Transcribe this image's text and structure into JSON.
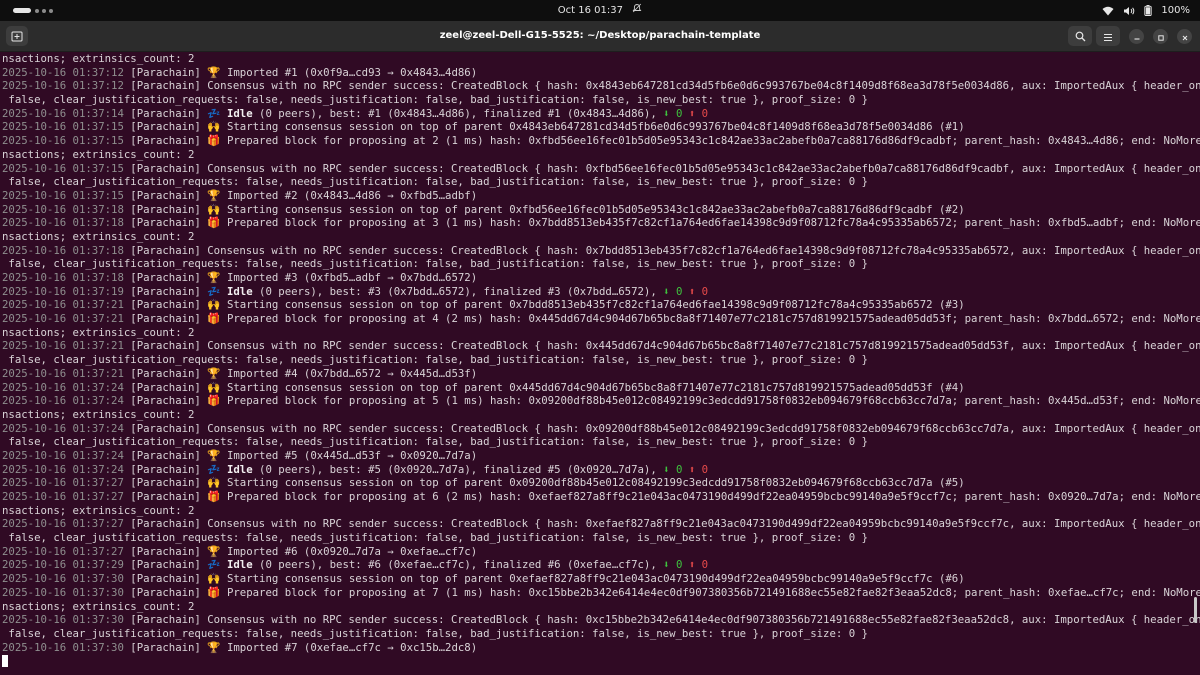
{
  "topbar": {
    "clock": "Oct 16  01:37",
    "battery": "100%",
    "icons": [
      "wifi-icon",
      "volume-icon",
      "battery-icon",
      "bell-muted-icon"
    ]
  },
  "window": {
    "title": "zeel@zeel-Dell-G15-5525: ~/Desktop/parachain-template",
    "buttons": [
      "new-tab-icon",
      "search-icon",
      "menu-icon",
      "minimize-icon",
      "maximize-icon",
      "close-icon"
    ]
  },
  "colors": {
    "background": "#300a24",
    "timestamp": "#8f8f8f",
    "text": "#d9d3d7",
    "green_arrow": "#3ec23e",
    "red_arrow": "#e64a4a"
  },
  "terminal": {
    "lines": [
      [
        {
          "t": "nsactions; extrinsics_count: 2"
        }
      ],
      [
        {
          "t": "2025-10-16 01:37:12",
          "c": "ts"
        },
        {
          "t": " [Parachain] 🏆 Imported #1 (0x0f9a…cd93 → 0x4843…4d86)"
        }
      ],
      [
        {
          "t": "2025-10-16 01:37:12",
          "c": "ts"
        },
        {
          "t": " [Parachain] Consensus with no RPC sender success: CreatedBlock { hash: 0x4843eb647281cd34d5fb6e0d6c993767be04c8f1409d8f68ea3d78f5e0034d86, aux: ImportedAux { header_only:"
        }
      ],
      [
        {
          "t": " false, clear_justification_requests: false, needs_justification: false, bad_justification: false, is_new_best: true }, proof_size: 0 }"
        }
      ],
      [
        {
          "t": "2025-10-16 01:37:14",
          "c": "ts"
        },
        {
          "t": " [Parachain] 💤 "
        },
        {
          "t": "Idle",
          "c": "bold"
        },
        {
          "t": " (0 peers), best: #1 (0x4843…4d86), finalized #1 (0x4843…4d86), "
        },
        {
          "t": "⬇ 0",
          "c": "green"
        },
        {
          "t": " "
        },
        {
          "t": "⬆ 0",
          "c": "red"
        }
      ],
      [
        {
          "t": "2025-10-16 01:37:15",
          "c": "ts"
        },
        {
          "t": " [Parachain] 🙌 Starting consensus session on top of parent 0x4843eb647281cd34d5fb6e0d6c993767be04c8f1409d8f68ea3d78f5e0034d86 (#1)"
        }
      ],
      [
        {
          "t": "2025-10-16 01:37:15",
          "c": "ts"
        },
        {
          "t": " [Parachain] 🎁 Prepared block for proposing at 2 (1 ms) hash: 0xfbd56ee16fec01b5d05e95343c1c842ae33ac2abefb0a7ca88176d86df9cadbf; parent_hash: 0x4843…4d86; end: NoMoreTra"
        }
      ],
      [
        {
          "t": "nsactions; extrinsics_count: 2"
        }
      ],
      [
        {
          "t": "2025-10-16 01:37:15",
          "c": "ts"
        },
        {
          "t": " [Parachain] Consensus with no RPC sender success: CreatedBlock { hash: 0xfbd56ee16fec01b5d05e95343c1c842ae33ac2abefb0a7ca88176d86df9cadbf, aux: ImportedAux { header_only:"
        }
      ],
      [
        {
          "t": " false, clear_justification_requests: false, needs_justification: false, bad_justification: false, is_new_best: true }, proof_size: 0 }"
        }
      ],
      [
        {
          "t": "2025-10-16 01:37:15",
          "c": "ts"
        },
        {
          "t": " [Parachain] 🏆 Imported #2 (0x4843…4d86 → 0xfbd5…adbf)"
        }
      ],
      [
        {
          "t": "2025-10-16 01:37:18",
          "c": "ts"
        },
        {
          "t": " [Parachain] 🙌 Starting consensus session on top of parent 0xfbd56ee16fec01b5d05e95343c1c842ae33ac2abefb0a7ca88176d86df9cadbf (#2)"
        }
      ],
      [
        {
          "t": "2025-10-16 01:37:18",
          "c": "ts"
        },
        {
          "t": " [Parachain] 🎁 Prepared block for proposing at 3 (1 ms) hash: 0x7bdd8513eb435f7c82cf1a764ed6fae14398c9d9f08712fc78a4c95335ab6572; parent_hash: 0xfbd5…adbf; end: NoMoreTra"
        }
      ],
      [
        {
          "t": "nsactions; extrinsics_count: 2"
        }
      ],
      [
        {
          "t": "2025-10-16 01:37:18",
          "c": "ts"
        },
        {
          "t": " [Parachain] Consensus with no RPC sender success: CreatedBlock { hash: 0x7bdd8513eb435f7c82cf1a764ed6fae14398c9d9f08712fc78a4c95335ab6572, aux: ImportedAux { header_only:"
        }
      ],
      [
        {
          "t": " false, clear_justification_requests: false, needs_justification: false, bad_justification: false, is_new_best: true }, proof_size: 0 }"
        }
      ],
      [
        {
          "t": "2025-10-16 01:37:18",
          "c": "ts"
        },
        {
          "t": " [Parachain] 🏆 Imported #3 (0xfbd5…adbf → 0x7bdd…6572)"
        }
      ],
      [
        {
          "t": "2025-10-16 01:37:19",
          "c": "ts"
        },
        {
          "t": " [Parachain] 💤 "
        },
        {
          "t": "Idle",
          "c": "bold"
        },
        {
          "t": " (0 peers), best: #3 (0x7bdd…6572), finalized #3 (0x7bdd…6572), "
        },
        {
          "t": "⬇ 0",
          "c": "green"
        },
        {
          "t": " "
        },
        {
          "t": "⬆ 0",
          "c": "red"
        }
      ],
      [
        {
          "t": "2025-10-16 01:37:21",
          "c": "ts"
        },
        {
          "t": " [Parachain] 🙌 Starting consensus session on top of parent 0x7bdd8513eb435f7c82cf1a764ed6fae14398c9d9f08712fc78a4c95335ab6572 (#3)"
        }
      ],
      [
        {
          "t": "2025-10-16 01:37:21",
          "c": "ts"
        },
        {
          "t": " [Parachain] 🎁 Prepared block for proposing at 4 (2 ms) hash: 0x445dd67d4c904d67b65bc8a8f71407e77c2181c757d819921575adead05dd53f; parent_hash: 0x7bdd…6572; end: NoMoreTra"
        }
      ],
      [
        {
          "t": "nsactions; extrinsics_count: 2"
        }
      ],
      [
        {
          "t": "2025-10-16 01:37:21",
          "c": "ts"
        },
        {
          "t": " [Parachain] Consensus with no RPC sender success: CreatedBlock { hash: 0x445dd67d4c904d67b65bc8a8f71407e77c2181c757d819921575adead05dd53f, aux: ImportedAux { header_only:"
        }
      ],
      [
        {
          "t": " false, clear_justification_requests: false, needs_justification: false, bad_justification: false, is_new_best: true }, proof_size: 0 }"
        }
      ],
      [
        {
          "t": "2025-10-16 01:37:21",
          "c": "ts"
        },
        {
          "t": " [Parachain] 🏆 Imported #4 (0x7bdd…6572 → 0x445d…d53f)"
        }
      ],
      [
        {
          "t": "2025-10-16 01:37:24",
          "c": "ts"
        },
        {
          "t": " [Parachain] 🙌 Starting consensus session on top of parent 0x445dd67d4c904d67b65bc8a8f71407e77c2181c757d819921575adead05dd53f (#4)"
        }
      ],
      [
        {
          "t": "2025-10-16 01:37:24",
          "c": "ts"
        },
        {
          "t": " [Parachain] 🎁 Prepared block for proposing at 5 (1 ms) hash: 0x09200df88b45e012c08492199c3edcdd91758f0832eb094679f68ccb63cc7d7a; parent_hash: 0x445d…d53f; end: NoMoreTra"
        }
      ],
      [
        {
          "t": "nsactions; extrinsics_count: 2"
        }
      ],
      [
        {
          "t": "2025-10-16 01:37:24",
          "c": "ts"
        },
        {
          "t": " [Parachain] Consensus with no RPC sender success: CreatedBlock { hash: 0x09200df88b45e012c08492199c3edcdd91758f0832eb094679f68ccb63cc7d7a, aux: ImportedAux { header_only:"
        }
      ],
      [
        {
          "t": " false, clear_justification_requests: false, needs_justification: false, bad_justification: false, is_new_best: true }, proof_size: 0 }"
        }
      ],
      [
        {
          "t": "2025-10-16 01:37:24",
          "c": "ts"
        },
        {
          "t": " [Parachain] 🏆 Imported #5 (0x445d…d53f → 0x0920…7d7a)"
        }
      ],
      [
        {
          "t": "2025-10-16 01:37:24",
          "c": "ts"
        },
        {
          "t": " [Parachain] 💤 "
        },
        {
          "t": "Idle",
          "c": "bold"
        },
        {
          "t": " (0 peers), best: #5 (0x0920…7d7a), finalized #5 (0x0920…7d7a), "
        },
        {
          "t": "⬇ 0",
          "c": "green"
        },
        {
          "t": " "
        },
        {
          "t": "⬆ 0",
          "c": "red"
        }
      ],
      [
        {
          "t": "2025-10-16 01:37:27",
          "c": "ts"
        },
        {
          "t": " [Parachain] 🙌 Starting consensus session on top of parent 0x09200df88b45e012c08492199c3edcdd91758f0832eb094679f68ccb63cc7d7a (#5)"
        }
      ],
      [
        {
          "t": "2025-10-16 01:37:27",
          "c": "ts"
        },
        {
          "t": " [Parachain] 🎁 Prepared block for proposing at 6 (2 ms) hash: 0xefaef827a8ff9c21e043ac0473190d499df22ea04959bcbc99140a9e5f9ccf7c; parent_hash: 0x0920…7d7a; end: NoMoreTra"
        }
      ],
      [
        {
          "t": "nsactions; extrinsics_count: 2"
        }
      ],
      [
        {
          "t": "2025-10-16 01:37:27",
          "c": "ts"
        },
        {
          "t": " [Parachain] Consensus with no RPC sender success: CreatedBlock { hash: 0xefaef827a8ff9c21e043ac0473190d499df22ea04959bcbc99140a9e5f9ccf7c, aux: ImportedAux { header_only:"
        }
      ],
      [
        {
          "t": " false, clear_justification_requests: false, needs_justification: false, bad_justification: false, is_new_best: true }, proof_size: 0 }"
        }
      ],
      [
        {
          "t": "2025-10-16 01:37:27",
          "c": "ts"
        },
        {
          "t": " [Parachain] 🏆 Imported #6 (0x0920…7d7a → 0xefae…cf7c)"
        }
      ],
      [
        {
          "t": "2025-10-16 01:37:29",
          "c": "ts"
        },
        {
          "t": " [Parachain] 💤 "
        },
        {
          "t": "Idle",
          "c": "bold"
        },
        {
          "t": " (0 peers), best: #6 (0xefae…cf7c), finalized #6 (0xefae…cf7c), "
        },
        {
          "t": "⬇ 0",
          "c": "green"
        },
        {
          "t": " "
        },
        {
          "t": "⬆ 0",
          "c": "red"
        }
      ],
      [
        {
          "t": "2025-10-16 01:37:30",
          "c": "ts"
        },
        {
          "t": " [Parachain] 🙌 Starting consensus session on top of parent 0xefaef827a8ff9c21e043ac0473190d499df22ea04959bcbc99140a9e5f9ccf7c (#6)"
        }
      ],
      [
        {
          "t": "2025-10-16 01:37:30",
          "c": "ts"
        },
        {
          "t": " [Parachain] 🎁 Prepared block for proposing at 7 (1 ms) hash: 0xc15bbe2b342e6414e4ec0df907380356b721491688ec55e82fae82f3eaa52dc8; parent_hash: 0xefae…cf7c; end: NoMoreTra"
        }
      ],
      [
        {
          "t": "nsactions; extrinsics_count: 2"
        }
      ],
      [
        {
          "t": "2025-10-16 01:37:30",
          "c": "ts"
        },
        {
          "t": " [Parachain] Consensus with no RPC sender success: CreatedBlock { hash: 0xc15bbe2b342e6414e4ec0df907380356b721491688ec55e82fae82f3eaa52dc8, aux: ImportedAux { header_only:"
        }
      ],
      [
        {
          "t": " false, clear_justification_requests: false, needs_justification: false, bad_justification: false, is_new_best: true }, proof_size: 0 }"
        }
      ],
      [
        {
          "t": "2025-10-16 01:37:30",
          "c": "ts"
        },
        {
          "t": " [Parachain] 🏆 Imported #7 (0xefae…cf7c → 0xc15b…2dc8)"
        }
      ]
    ]
  }
}
